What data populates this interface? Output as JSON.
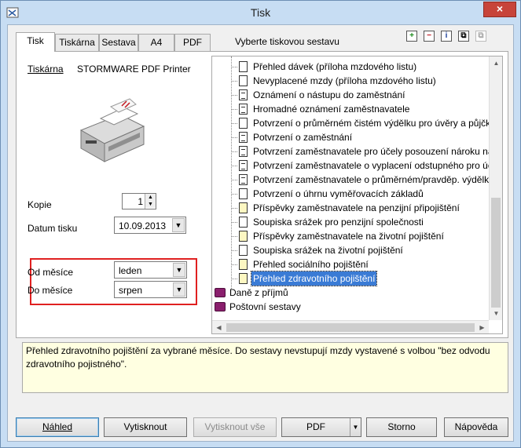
{
  "window": {
    "title": "Tisk",
    "close_label": "×"
  },
  "tabs": [
    {
      "label": "Tisk"
    },
    {
      "label": "Tiskárna"
    },
    {
      "label": "Sestava"
    },
    {
      "label": "A4"
    },
    {
      "label": "PDF"
    }
  ],
  "report_prompt": "Vyberte tiskovou sestavu",
  "toolbar_icons": [
    "add-icon",
    "remove-icon",
    "info-icon",
    "copy-icon",
    "copy-disabled-icon"
  ],
  "left": {
    "printer_label": "Tiskárna",
    "printer_name": "STORMWARE PDF Printer",
    "copies_label": "Kopie",
    "copies_value": "1",
    "print_date_label": "Datum tisku",
    "print_date_value": "10.09.2013",
    "from_month_label": "Od měsíce",
    "from_month_value": "leden",
    "to_month_label": "Do měsíce",
    "to_month_value": "srpen"
  },
  "tree": {
    "items": [
      {
        "label": "Přehled dávek (příloha mzdového listu)",
        "icon": "doc"
      },
      {
        "label": "Nevyplacené mzdy (příloha mzdového listu)",
        "icon": "doc"
      },
      {
        "label": "Oznámení o nástupu do zaměstnání",
        "icon": "doc-filled"
      },
      {
        "label": "Hromadné oznámení zaměstnavatele",
        "icon": "doc-filled"
      },
      {
        "label": "Potvrzení o průměrném čistém výdělku pro úvěry a půjčky",
        "icon": "doc"
      },
      {
        "label": "Potvrzení o zaměstnání",
        "icon": "doc-filled"
      },
      {
        "label": "Potvrzení zaměstnavatele pro účely posouzení nároku na p",
        "icon": "doc-filled"
      },
      {
        "label": "Potvrzení zaměstnavatele o vyplacení odstupného pro úče",
        "icon": "doc-filled"
      },
      {
        "label": "Potvrzení zaměstnavatele o průměrném/pravděp. výdělku",
        "icon": "doc-filled"
      },
      {
        "label": "Potvrzení o úhrnu vyměřovacích základů",
        "icon": "doc"
      },
      {
        "label": "Příspěvky zaměstnavatele na penzijní připojištění",
        "icon": "doc-yellow"
      },
      {
        "label": "Soupiska srážek pro penzijní společnosti",
        "icon": "doc"
      },
      {
        "label": "Příspěvky zaměstnavatele na životní pojištění",
        "icon": "doc-yellow"
      },
      {
        "label": "Soupiska srážek na životní pojištění",
        "icon": "doc"
      },
      {
        "label": "Přehled sociálního pojištění",
        "icon": "doc-yellow"
      },
      {
        "label": "Přehled zdravotního pojištění",
        "icon": "doc-yellow",
        "selected": true
      }
    ],
    "folders": [
      {
        "label": "Daně z příjmů"
      },
      {
        "label": "Poštovní sestavy"
      }
    ]
  },
  "description": "Přehled zdravotního pojištění za vybrané měsíce. Do sestavy nevstupují mzdy vystavené s volbou \"bez odvodu zdravotního pojistného\".",
  "buttons": {
    "preview": "Náhled",
    "print": "Vytisknout",
    "print_all": "Vytisknout vše",
    "pdf": "PDF",
    "cancel": "Storno",
    "help": "Nápověda"
  }
}
